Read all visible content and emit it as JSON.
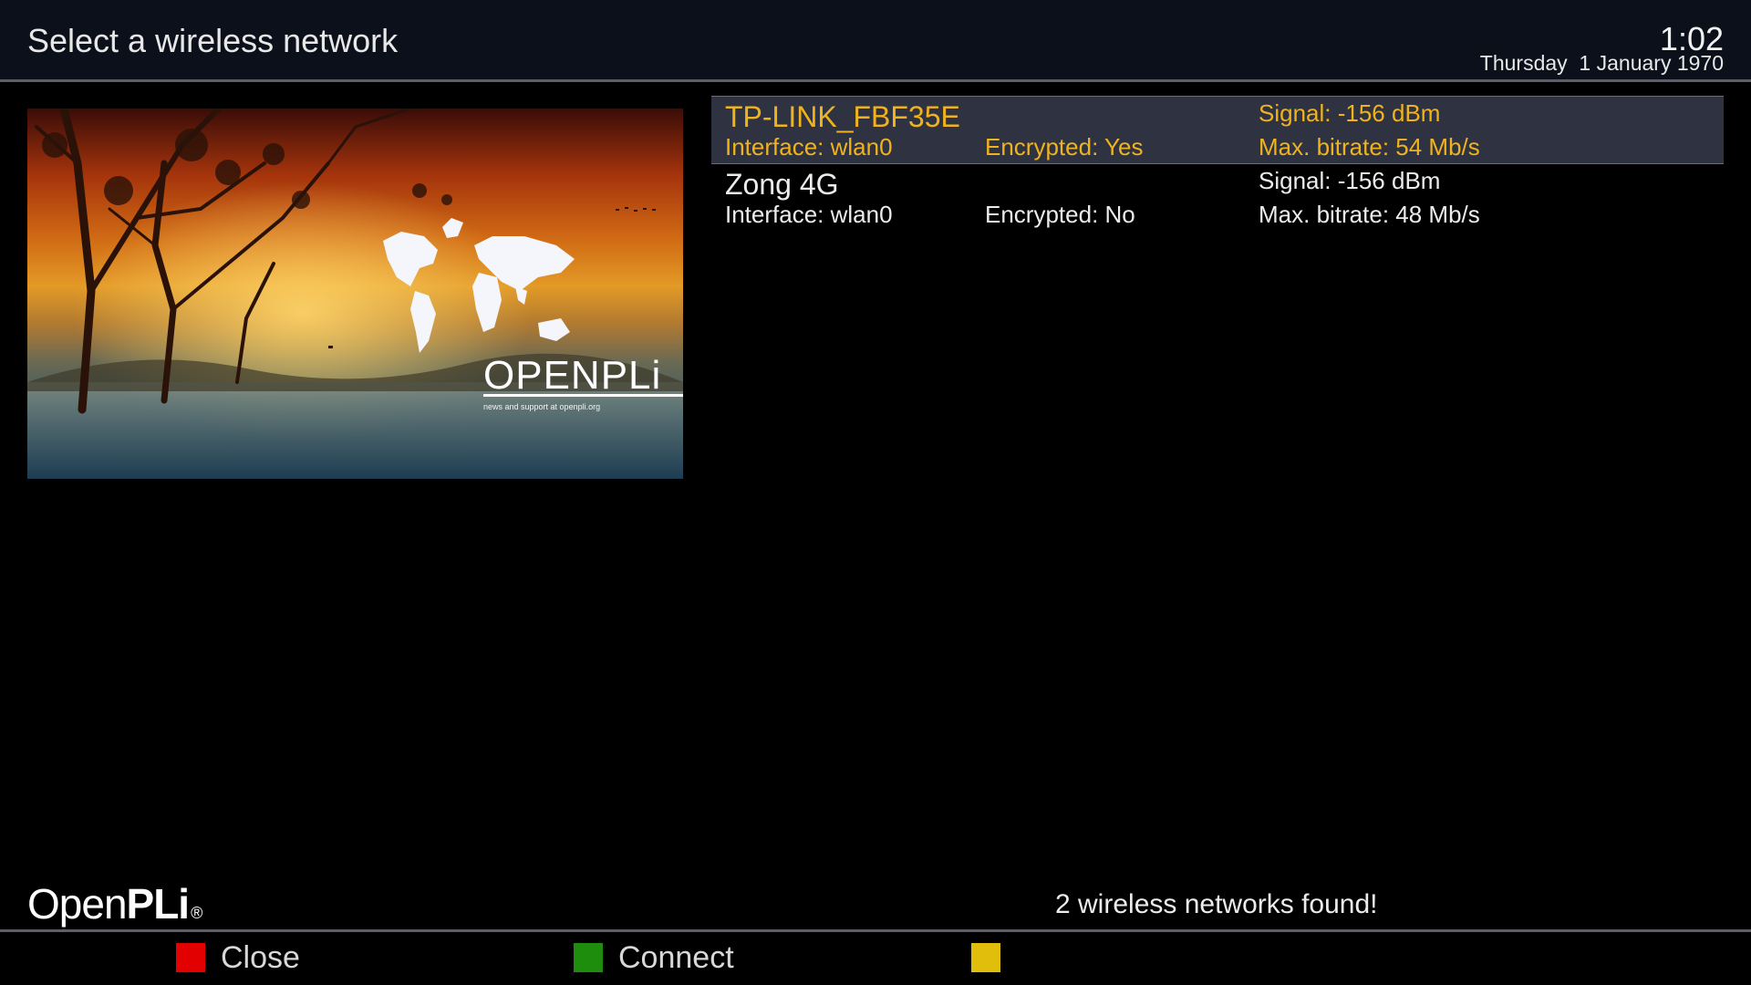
{
  "header": {
    "title": "Select a wireless network",
    "time": "1:02",
    "date": "Thursday  1 January 1970"
  },
  "preview": {
    "brand": "OPENPLi",
    "tagline": "news and support at openpli.org",
    "registered_mark": "®"
  },
  "networks": [
    {
      "ssid": "TP-LINK_FBF35E",
      "interface": "Interface: wlan0",
      "encrypted": "Encrypted: Yes",
      "signal": "Signal: -156 dBm",
      "bitrate": "Max. bitrate: 54 Mb/s",
      "selected": true
    },
    {
      "ssid": "Zong 4G",
      "interface": "Interface: wlan0",
      "encrypted": "Encrypted: No",
      "signal": "Signal: -156 dBm",
      "bitrate": "Max. bitrate: 48 Mb/s",
      "selected": false
    }
  ],
  "footer": {
    "logo_light": "Open",
    "logo_bold": "PLi",
    "logo_mark": "®",
    "status": "2 wireless networks found!",
    "buttons": {
      "red_label": "Close",
      "green_label": "Connect",
      "yellow_label": ""
    }
  },
  "colors": {
    "header_bg": "#0c101b",
    "selected_text": "#f0b31d",
    "selected_bg": "#2f3341",
    "key_red": "#e30000",
    "key_green": "#1e8c0c",
    "key_yellow": "#e1bd0c"
  }
}
